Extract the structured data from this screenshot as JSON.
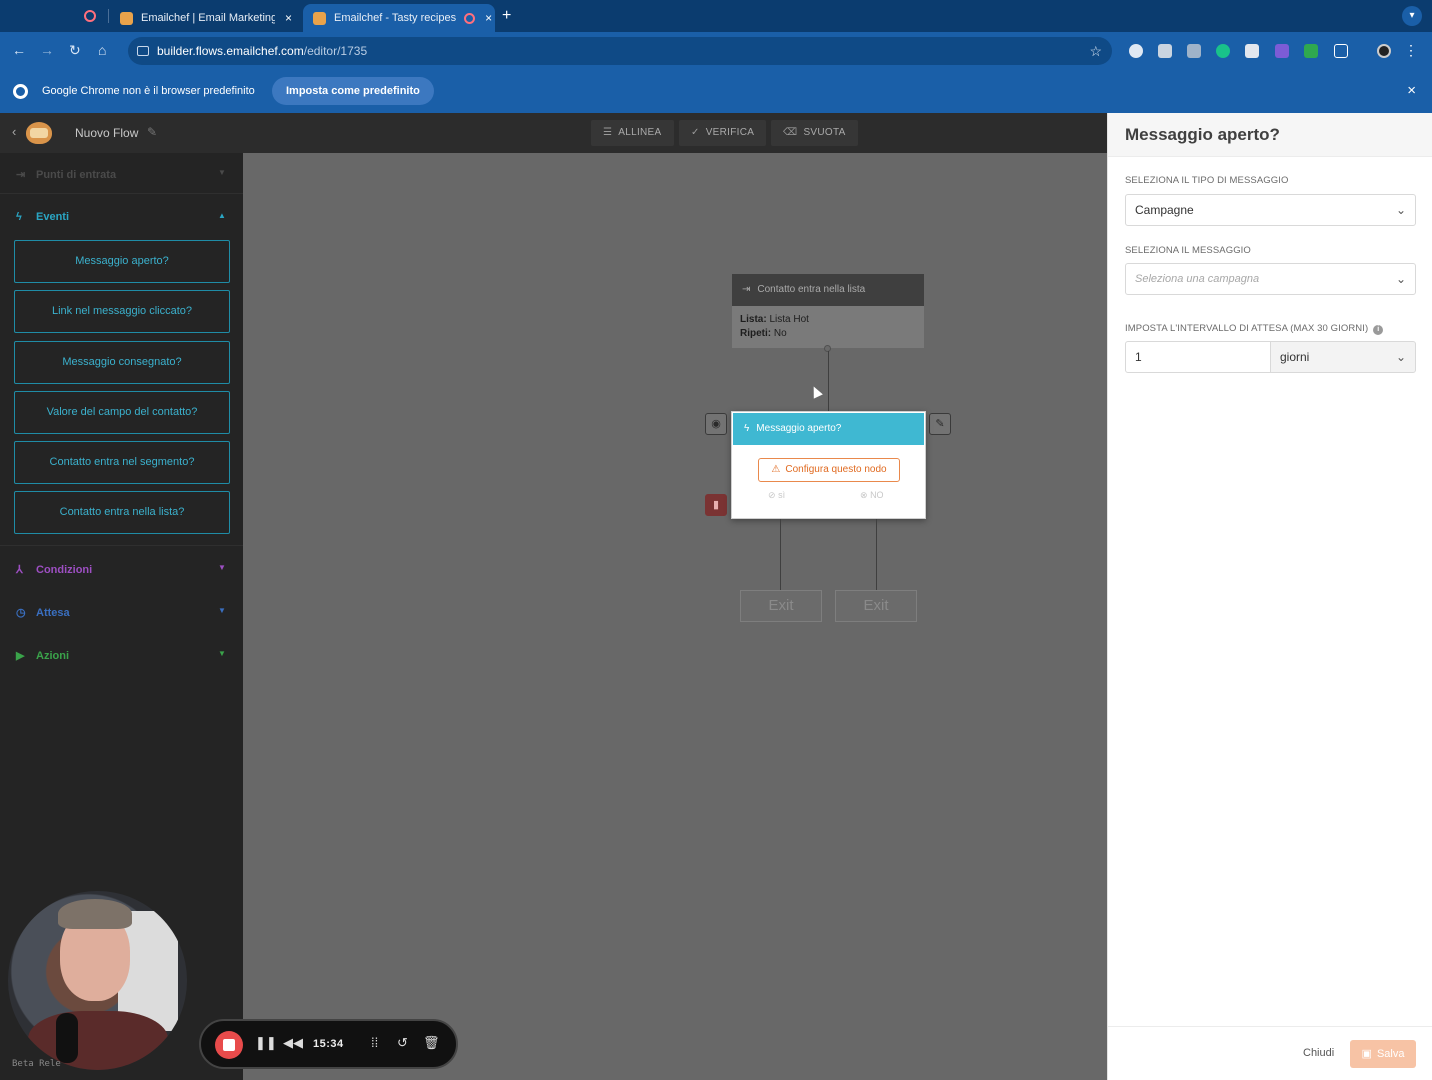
{
  "browser": {
    "tabs": [
      {
        "title": "Emailchef | Email Marketing A",
        "close": "×"
      },
      {
        "title": "Emailchef - Tasty recipes",
        "close": "×"
      }
    ],
    "new_tab": "+",
    "url_host": "builder.flows.emailchef.com",
    "url_path": "/editor/1735"
  },
  "banner": {
    "message": "Google Chrome non è il browser predefinito",
    "button": "Imposta come predefinito",
    "close": "×"
  },
  "header": {
    "flow_name": "Nuovo Flow",
    "buttons": {
      "allinea": "ALLINEA",
      "verifica": "VERIFICA",
      "svuota": "SVUOTA"
    }
  },
  "sidebar": {
    "punti_di_entrata": "Punti di entrata",
    "eventi": "Eventi",
    "event_items": [
      "Messaggio aperto?",
      "Link nel messaggio cliccato?",
      "Messaggio consegnato?",
      "Valore del campo del contatto?",
      "Contatto entra nel segmento?",
      "Contatto entra nella lista?"
    ],
    "condizioni": "Condizioni",
    "attesa": "Attesa",
    "azioni": "Azioni",
    "colors": {
      "eventi": "#2aa6c4",
      "condizioni": "#9d4fc2",
      "attesa": "#3a6fc0",
      "azioni": "#3aa34a"
    }
  },
  "canvas": {
    "entry_node": {
      "title": "Contatto entra nella lista",
      "lista_label": "Lista:",
      "lista_value": "Lista Hot",
      "ripeti_label": "Ripeti:",
      "ripeti_value": "No"
    },
    "event_node": {
      "title": "Messaggio aperto?",
      "warning": "Configura questo nodo",
      "yes": "sì",
      "no": "NO"
    },
    "exit_left": "Exit",
    "exit_right": "Exit"
  },
  "panel": {
    "title": "Messaggio aperto?",
    "tipo_label": "SELEZIONA IL TIPO DI MESSAGGIO",
    "tipo_value": "Campagne",
    "messaggio_label": "SELEZIONA IL MESSAGGIO",
    "messaggio_placeholder": "Seleziona una campagna",
    "intervallo_label": "IMPOSTA L'INTERVALLO DI ATTESA (MAX 30 GIORNI)",
    "intervallo_value": "1",
    "intervallo_unit": "giorni",
    "chiudi": "Chiudi",
    "salva": "Salva"
  },
  "recorder": {
    "time": "15:34",
    "beta_text": "Beta Rele"
  }
}
